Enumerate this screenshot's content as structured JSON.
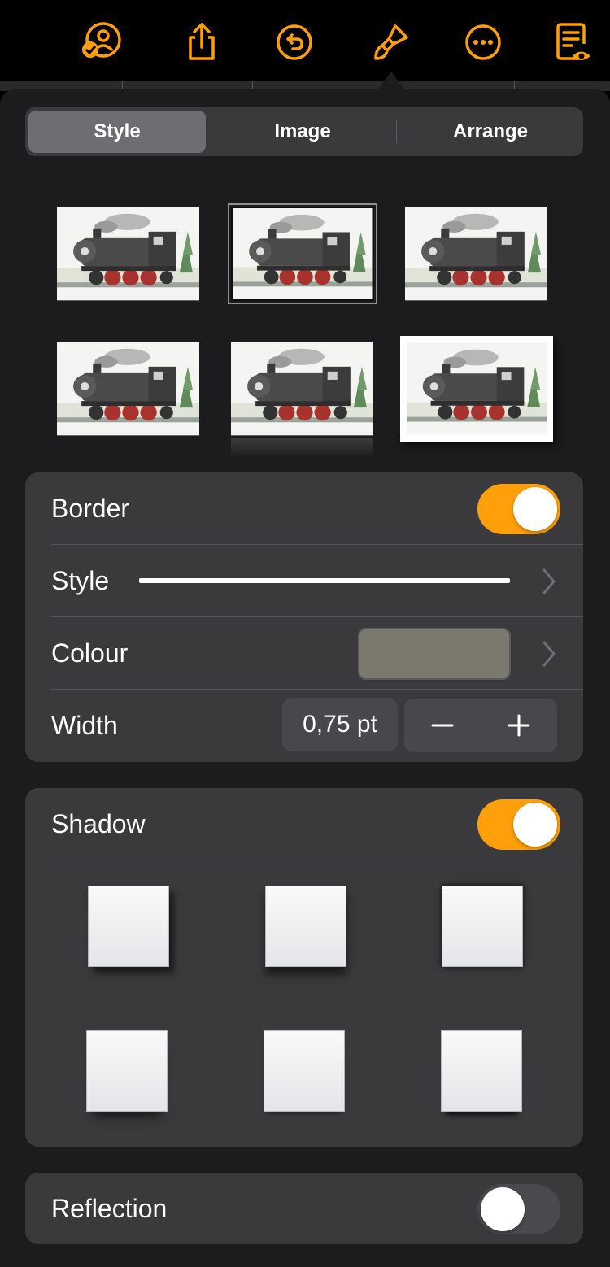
{
  "toolbar": {
    "buttons": [
      {
        "name": "collaborate-icon"
      },
      {
        "name": "share-icon"
      },
      {
        "name": "undo-icon"
      },
      {
        "name": "format-brush-icon"
      },
      {
        "name": "more-icon"
      },
      {
        "name": "reading-view-icon"
      }
    ],
    "accent": "#ff9f0a"
  },
  "tabs": [
    {
      "label": "Style",
      "active": true
    },
    {
      "label": "Image",
      "active": false
    },
    {
      "label": "Arrange",
      "active": false
    }
  ],
  "style_presets": {
    "selected_index": 1,
    "count": 6
  },
  "border": {
    "label": "Border",
    "enabled": true,
    "style_label": "Style",
    "colour_label": "Colour",
    "colour_value": "#7b786e",
    "width_label": "Width",
    "width_value": "0,75 pt",
    "minus_symbol": "−",
    "plus_symbol": "+"
  },
  "shadow": {
    "label": "Shadow",
    "enabled": true,
    "presets_count": 6
  },
  "reflection": {
    "label": "Reflection",
    "enabled": false
  }
}
